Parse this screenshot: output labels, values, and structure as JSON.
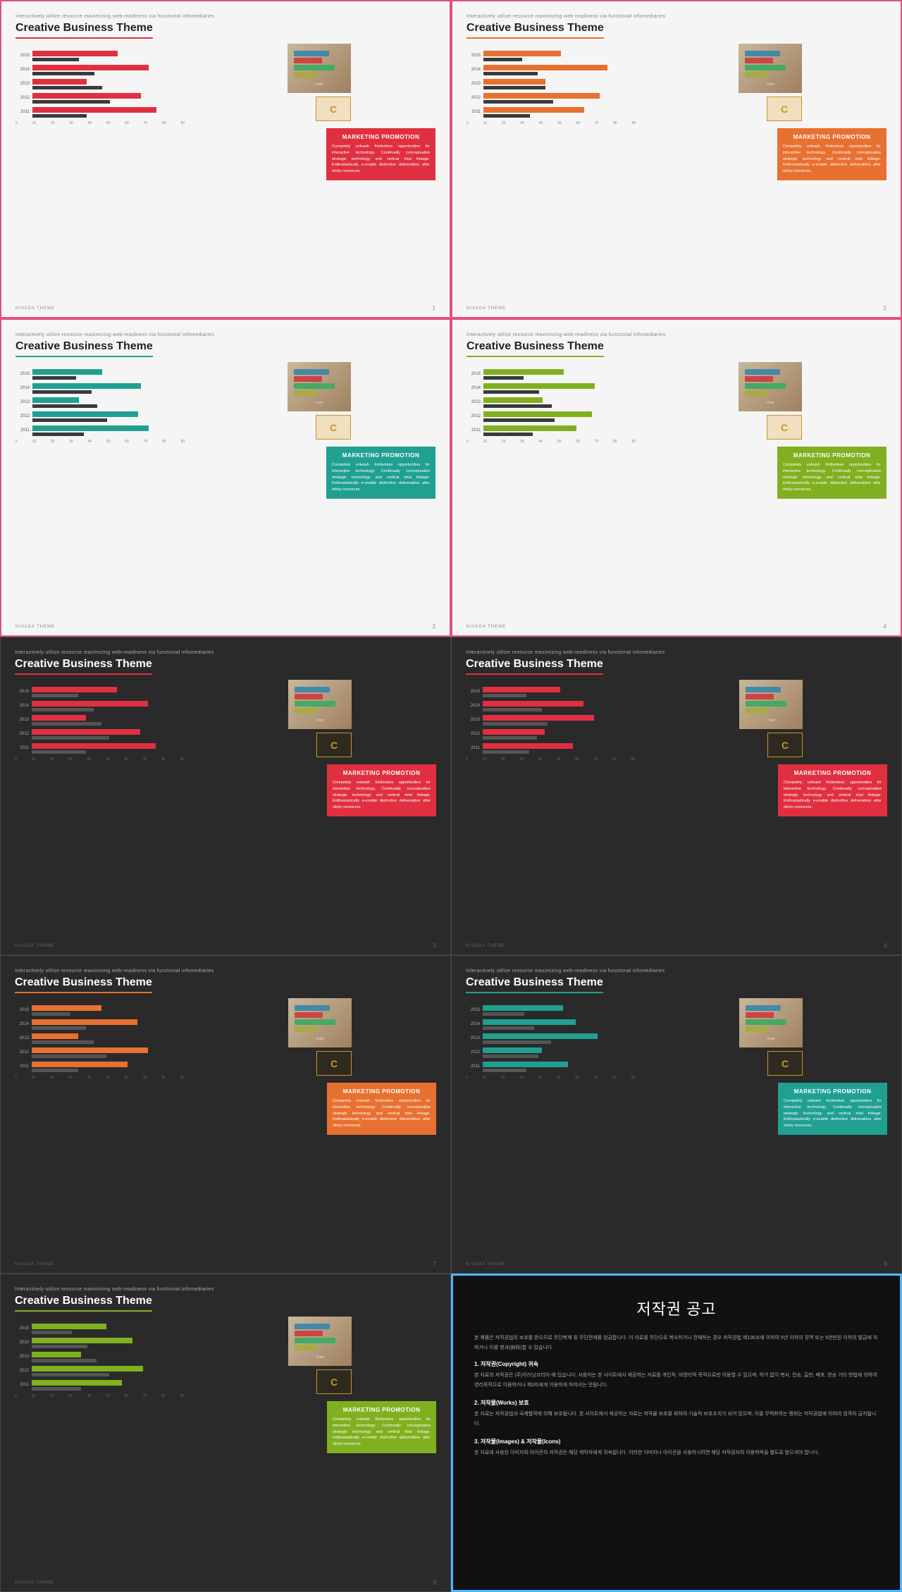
{
  "slides": [
    {
      "id": 1,
      "theme": "light",
      "border": "pink",
      "accent": "red",
      "subtitle": "Interactively utilize resource maximizing web-readiness via functional infomediaries",
      "title": "Creative Business Theme",
      "bars": [
        {
          "year": "2015",
          "accent": 55,
          "dark": 30
        },
        {
          "year": "2014",
          "accent": 75,
          "dark": 40
        },
        {
          "year": "2013",
          "accent": 35,
          "dark": 45
        },
        {
          "year": "2012",
          "accent": 70,
          "dark": 50
        },
        {
          "year": "2011",
          "accent": 80,
          "dark": 35
        }
      ],
      "infoTitle": "MARKETING PROMOTION",
      "infoText": "Competely unleash frictionless opportunities for interactive technology. Continually conceptualize strategic technology and vertical total linkage. Enthusiastically e-enable distinctive deliverables after sticky resources.",
      "page": "1",
      "brand": "NIVADA THEME"
    },
    {
      "id": 2,
      "theme": "light",
      "border": "pink",
      "accent": "orange",
      "subtitle": "Interactively utilize resource maximizing web-readiness via functional infomediaries",
      "title": "Creative Business Theme",
      "bars": [
        {
          "year": "2015",
          "accent": 50,
          "dark": 25
        },
        {
          "year": "2014",
          "accent": 80,
          "dark": 35
        },
        {
          "year": "2013",
          "accent": 40,
          "dark": 40
        },
        {
          "year": "2012",
          "accent": 75,
          "dark": 45
        },
        {
          "year": "2011",
          "accent": 65,
          "dark": 30
        }
      ],
      "infoTitle": "MARKETING PROMOTION",
      "infoText": "Competely unleash frictionless opportunities for interactive technology. Continually conceptualize strategic technology and vertical total linkage. Enthusiastically e-enable distinctive deliverables after sticky resources.",
      "page": "2",
      "brand": "NIVADA THEME"
    },
    {
      "id": 3,
      "theme": "light",
      "border": "pink",
      "accent": "teal",
      "subtitle": "Interactively utilize resource maximizing web-readiness via functional infomediaries",
      "title": "Creative Business Theme",
      "bars": [
        {
          "year": "2015",
          "accent": 45,
          "dark": 28
        },
        {
          "year": "2014",
          "accent": 70,
          "dark": 38
        },
        {
          "year": "2013",
          "accent": 30,
          "dark": 42
        },
        {
          "year": "2012",
          "accent": 68,
          "dark": 48
        },
        {
          "year": "2011",
          "accent": 75,
          "dark": 33
        }
      ],
      "infoTitle": "MARKETING PROMOTION",
      "infoText": "Competely unleash frictionless opportunities for interactive technology. Continually conceptualize strategic technology and vertical total linkage. Enthusiastically e-enable distinctive deliverables after sticky resources.",
      "page": "3",
      "brand": "NIVADA THEME"
    },
    {
      "id": 4,
      "theme": "light",
      "border": "pink",
      "accent": "green",
      "subtitle": "Interactively utilize resource maximizing web-readiness via functional infomediaries",
      "title": "Creative Business Theme",
      "bars": [
        {
          "year": "2015",
          "accent": 52,
          "dark": 26
        },
        {
          "year": "2014",
          "accent": 72,
          "dark": 36
        },
        {
          "year": "2013",
          "accent": 38,
          "dark": 44
        },
        {
          "year": "2012",
          "accent": 70,
          "dark": 46
        },
        {
          "year": "2011",
          "accent": 60,
          "dark": 32
        }
      ],
      "infoTitle": "MARKETING PROMOTION",
      "infoText": "Competely unleash frictionless opportunities for interactive technology. Continually conceptualize strategic technology and vertical total linkage. Enthusiastically e-enable distinctive deliverables after sticky resources.",
      "page": "4",
      "brand": "NIVADA THEME"
    },
    {
      "id": 5,
      "theme": "dark",
      "border": "none",
      "accent": "red",
      "subtitle": "Interactively utilize resource maximizing web-readiness via functional infomediaries",
      "title": "Creative Business Theme",
      "bars": [
        {
          "year": "2015",
          "accent": 55,
          "dark": 30
        },
        {
          "year": "2014",
          "accent": 75,
          "dark": 40
        },
        {
          "year": "2013",
          "accent": 35,
          "dark": 45
        },
        {
          "year": "2012",
          "accent": 70,
          "dark": 50
        },
        {
          "year": "2011",
          "accent": 80,
          "dark": 35
        }
      ],
      "infoTitle": "MARKETING PROMOTION",
      "infoText": "Competely unleash frictionless opportunities for interactive technology. Continually conceptualize strategic technology and vertical total linkage. Enthusiastically e-enable distinctive deliverables after sticky resources.",
      "page": "5",
      "brand": "NIVADA THEME"
    },
    {
      "id": 6,
      "theme": "dark",
      "border": "none",
      "accent": "red",
      "subtitle": "Interactively utilize resource maximizing web-readiness via functional infomediaries",
      "title": "Creative Business Theme",
      "bars": [
        {
          "year": "2015",
          "accent": 50,
          "dark": 28
        },
        {
          "year": "2014",
          "accent": 65,
          "dark": 38
        },
        {
          "year": "2013",
          "accent": 72,
          "dark": 42
        },
        {
          "year": "2012",
          "accent": 40,
          "dark": 35
        },
        {
          "year": "2011",
          "accent": 58,
          "dark": 30
        }
      ],
      "infoTitle": "MARKETING PROMOTION",
      "infoText": "Competely unleash frictionless opportunities for interactive technology. Continually conceptualize strategic technology and vertical total linkage. Enthusiastically e-enable distinctive deliverables after sticky resources.",
      "page": "6",
      "brand": "NIVADA THEME"
    },
    {
      "id": 7,
      "theme": "dark",
      "border": "none",
      "accent": "orange",
      "subtitle": "Interactively utilize resource maximizing web-readiness via functional infomediaries",
      "title": "Creative Business Theme",
      "bars": [
        {
          "year": "2015",
          "accent": 45,
          "dark": 25
        },
        {
          "year": "2014",
          "accent": 68,
          "dark": 35
        },
        {
          "year": "2013",
          "accent": 30,
          "dark": 40
        },
        {
          "year": "2012",
          "accent": 75,
          "dark": 48
        },
        {
          "year": "2011",
          "accent": 62,
          "dark": 30
        }
      ],
      "infoTitle": "MARKETING PROMOTION",
      "infoText": "Competely unleash frictionless opportunities for interactive technology. Continually conceptualize strategic technology and vertical total linkage. Enthusiastically e-enable distinctive deliverables after sticky resources.",
      "page": "7",
      "brand": "NIVADA THEME"
    },
    {
      "id": 8,
      "theme": "dark",
      "border": "none",
      "accent": "teal",
      "subtitle": "Interactively utilize resource maximizing web-readiness via functional infomediaries",
      "title": "Creative Business Theme",
      "bars": [
        {
          "year": "2015",
          "accent": 52,
          "dark": 27
        },
        {
          "year": "2014",
          "accent": 60,
          "dark": 33
        },
        {
          "year": "2013",
          "accent": 74,
          "dark": 44
        },
        {
          "year": "2012",
          "accent": 38,
          "dark": 36
        },
        {
          "year": "2011",
          "accent": 55,
          "dark": 28
        }
      ],
      "infoTitle": "MARKETING PROMOTION",
      "infoText": "Competely unleash frictionless opportunities for interactive technology. Continually conceptualize strategic technology and vertical total linkage. Enthusiastically e-enable distinctive deliverables after sticky resources.",
      "page": "8",
      "brand": "NIVADA THEME"
    },
    {
      "id": 9,
      "theme": "dark",
      "border": "none",
      "accent": "green",
      "subtitle": "Interactively utilize resource maximizing web-readiness via functional infomediaries",
      "title": "Creative Business Theme",
      "bars": [
        {
          "year": "2015",
          "accent": 48,
          "dark": 26
        },
        {
          "year": "2014",
          "accent": 65,
          "dark": 36
        },
        {
          "year": "2013",
          "accent": 32,
          "dark": 42
        },
        {
          "year": "2012",
          "accent": 72,
          "dark": 50
        },
        {
          "year": "2011",
          "accent": 58,
          "dark": 32
        }
      ],
      "infoTitle": "MARKETING PROMOTION",
      "infoText": "Competely unleash frictionless opportunities for interactive technology. Continually conceptualize strategic technology and vertical total linkage. Enthusiastically e-enable distinctive deliverables after sticky resources.",
      "page": "9",
      "brand": "NIVADA THEME"
    }
  ],
  "copyright": {
    "title": "저작권 공고",
    "sections": [
      {
        "body": "본 제품은 저작권법의 보호를 받으므로 무단복제 및 무단전재를 엄금합니다. 이 자료를 무단으로 복사하거나 전재하는 경우 저작권법 제136조에 의하여 5년 이하의 징역 또는 5천만원 이하의 벌금에 처하거나 이를 병과(倂科)할 수 있습니다."
      },
      {
        "label": "1. 저작권(Copyright) 귀속",
        "body": "본 자료의 저작권은 (주)이러닝코리아-에 있습니다. 사용자는 본 사이트에서 제공하는 자료를 개인적, 비영리적 목적으로만 이용할 수 있으며, 허가 없이 복사, 전송, 출판, 배포, 방송 기타 방법에 의하여 영리목적으로 이용하거나 제3자에게 이용하게 하여서는 안됩니다."
      },
      {
        "label": "2. 저작물(Works) 보호",
        "body": "본 자료는 저작권법과 국제협약에 의해 보호됩니다. 본 사이트에서 제공하는 자료는 저작물 보호를 위하여 기술적 보호조치가 되어 있으며, 이를 무력화하는 행위는 저작권법에 의하여 엄격히 금지됩니다."
      },
      {
        "label": "3. 저작물(Images) & 저작물(Icons)",
        "body": "본 자료에 사용된 이미지와 아이콘의 저작권은 해당 제작자에게 귀속됩니다. 이러한 이미지나 아이콘을 사용하시려면 해당 저작권자의 이용허락을 별도로 받으셔야 합니다."
      }
    ]
  },
  "xAxisLabels": [
    "0",
    "10",
    "20",
    "30",
    "40",
    "50",
    "60",
    "70",
    "80",
    "90"
  ]
}
